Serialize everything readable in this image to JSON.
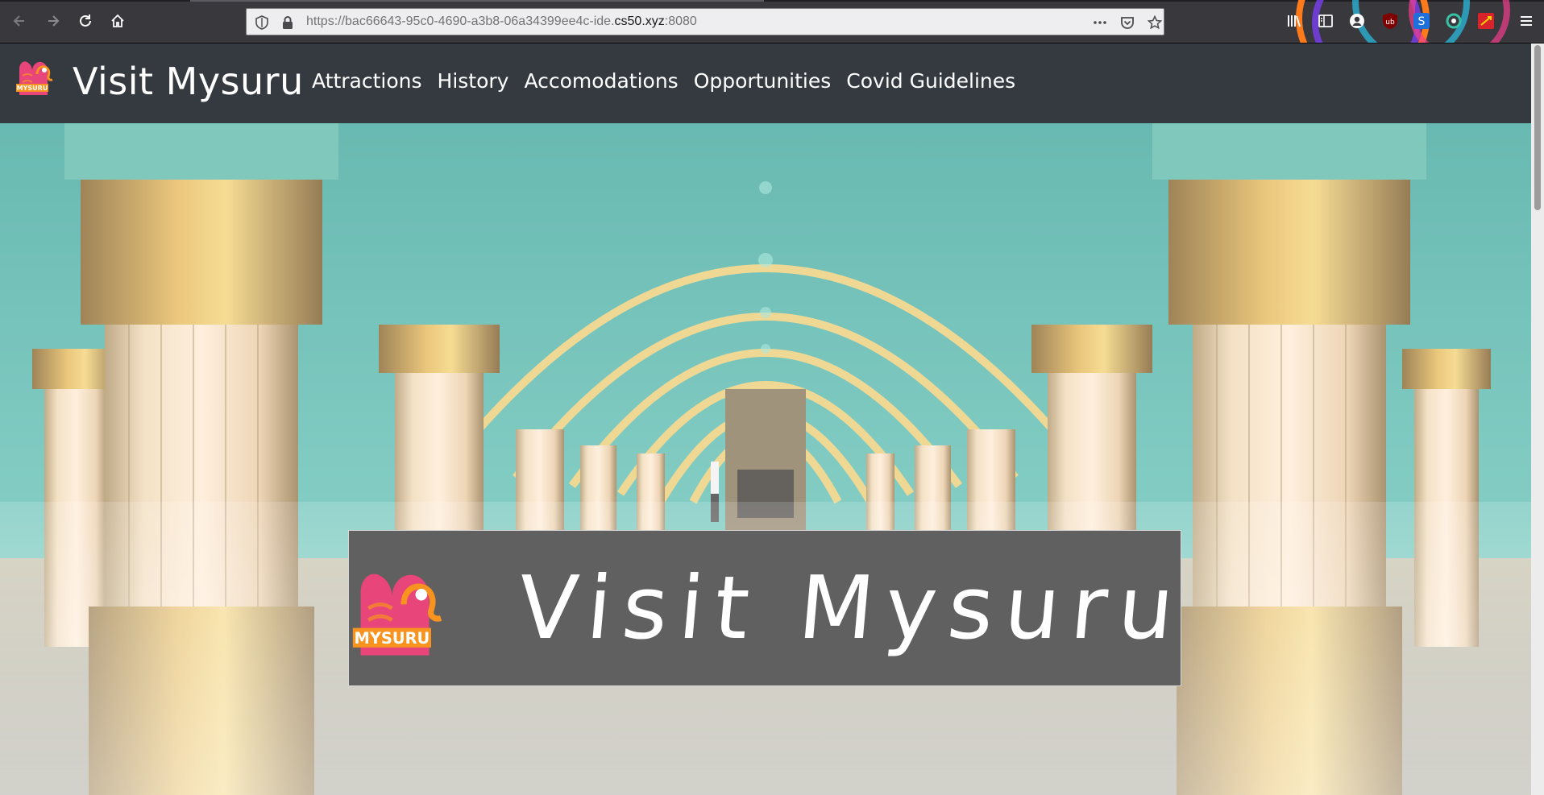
{
  "browser": {
    "url_prefix": "https://bac66643-95c0-4690-a3b8-06a34399ee4c-ide.",
    "url_domain": "cs50.xyz",
    "url_suffix": ":8080",
    "icons": [
      "back-icon",
      "forward-icon",
      "reload-icon",
      "home-icon",
      "shield-icon",
      "lock-icon",
      "more-icon",
      "pocket-icon",
      "star-icon",
      "library-icon",
      "sidebar-icon",
      "account-icon",
      "ublock-icon",
      "extension-s-icon",
      "sync-icon",
      "extension-red-icon",
      "menu-icon"
    ]
  },
  "site": {
    "brand_name": "Visit Mysuru",
    "logo_text": "MYSURU",
    "nav": [
      {
        "label": "Attractions"
      },
      {
        "label": "History"
      },
      {
        "label": "Accomodations"
      },
      {
        "label": "Opportunities"
      },
      {
        "label": "Covid Guidelines"
      }
    ],
    "hero_title": "Visit Mysuru",
    "hero_image": "mysore-palace-durbar-hall"
  },
  "colors": {
    "navbar_bg": "#343a40",
    "banner_bg": "#606060",
    "logo_pink": "#e8457a",
    "logo_orange": "#f7931e"
  }
}
